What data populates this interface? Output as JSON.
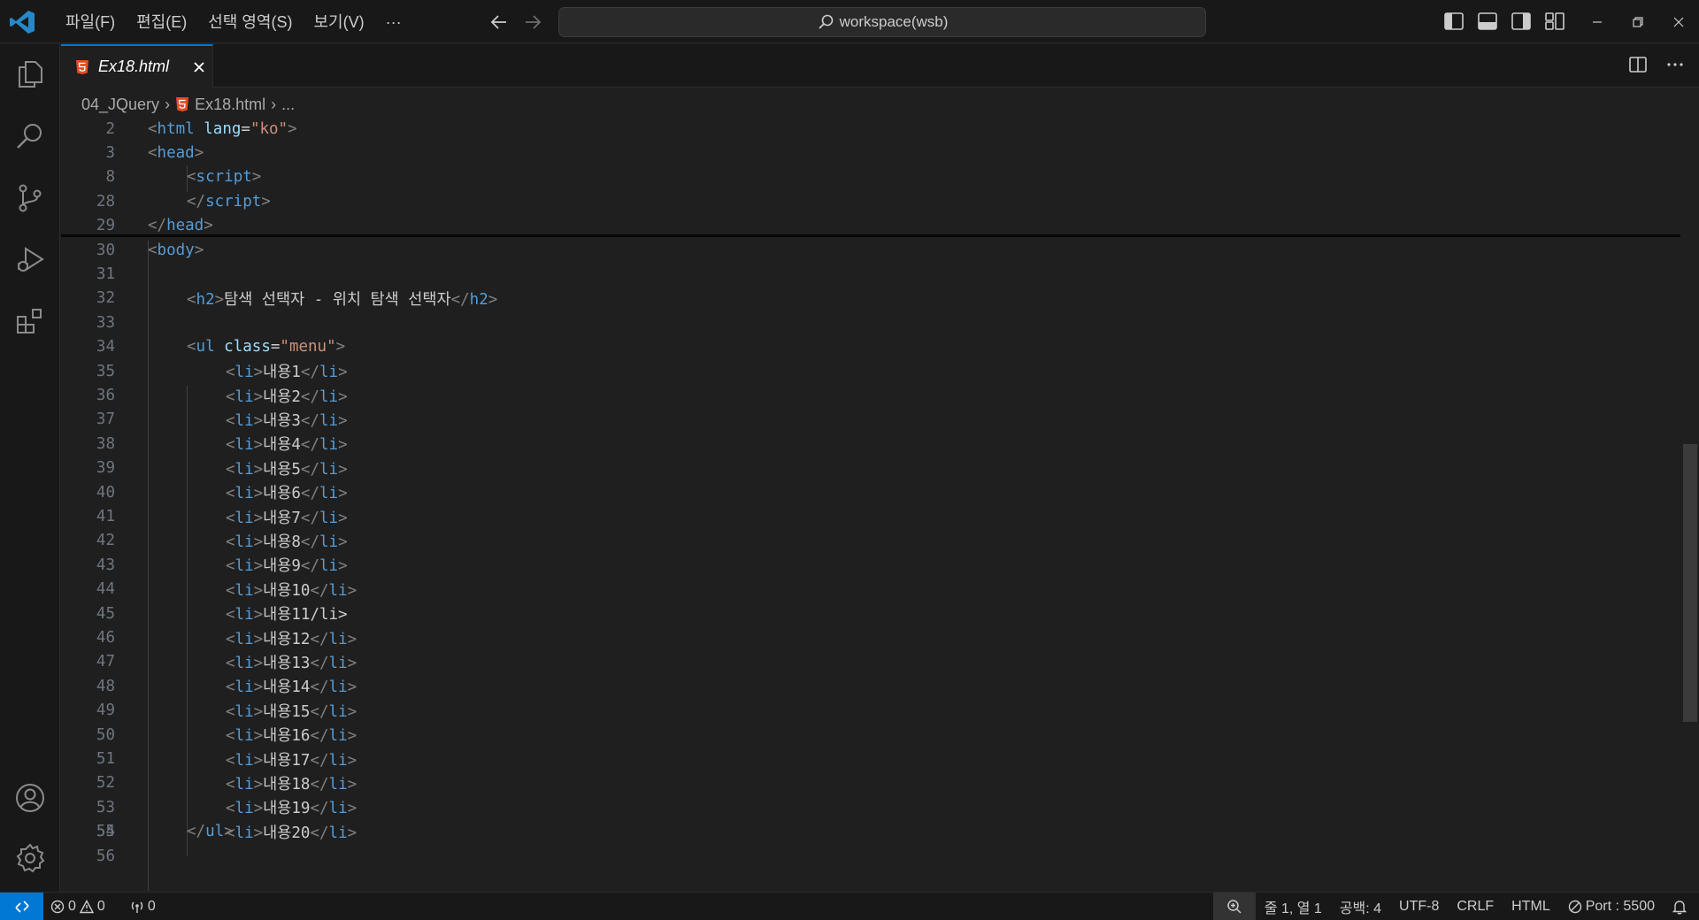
{
  "titlebar": {
    "menus": [
      "파일(F)",
      "편집(E)",
      "선택 영역(S)",
      "보기(V)",
      "···"
    ],
    "search_text": "workspace(wsb)"
  },
  "tab": {
    "label": "Ex18.html",
    "icon": "html5-icon"
  },
  "breadcrumb": {
    "folder": "04_JQuery",
    "file": "Ex18.html",
    "more": "..."
  },
  "code_lines": [
    {
      "n": "2"
    },
    {
      "n": "3"
    },
    {
      "n": "8"
    },
    {
      "n": "28"
    },
    {
      "n": "29"
    },
    {
      "n": "30"
    },
    {
      "n": "31"
    },
    {
      "n": "32"
    },
    {
      "n": "33"
    },
    {
      "n": "34"
    },
    {
      "n": "35"
    },
    {
      "n": "36"
    },
    {
      "n": "37"
    },
    {
      "n": "38"
    },
    {
      "n": "39"
    },
    {
      "n": "40"
    },
    {
      "n": "41"
    },
    {
      "n": "42"
    },
    {
      "n": "43"
    },
    {
      "n": "44"
    },
    {
      "n": "45"
    },
    {
      "n": "46"
    },
    {
      "n": "47"
    },
    {
      "n": "48"
    },
    {
      "n": "49"
    },
    {
      "n": "50"
    },
    {
      "n": "51"
    },
    {
      "n": "52"
    },
    {
      "n": "53"
    },
    {
      "n": "54"
    },
    {
      "n": "55"
    },
    {
      "n": "56"
    }
  ],
  "code": {
    "html_lang_attr": "lang",
    "html_lang_val": "\"ko\"",
    "ul_class_attr": "class",
    "ul_class_val": "\"menu\"",
    "h2_text": "탐색 선택자 - 위치 탐색 선택자",
    "li_prefix": "내용",
    "li_numbers": [
      "1",
      "2",
      "3",
      "4",
      "5",
      "6",
      "7",
      "8",
      "9",
      "10",
      "11",
      "12",
      "13",
      "14",
      "15",
      "16",
      "17",
      "18",
      "19",
      "20"
    ],
    "line45_tail": "/li>"
  },
  "statusbar": {
    "errors": "0",
    "warnings": "0",
    "ports": "0",
    "position": "줄 1, 열 1",
    "indent": "공백: 4",
    "encoding": "UTF-8",
    "eol": "CRLF",
    "language": "HTML",
    "port": "Port : 5500"
  },
  "colors": {
    "accent": "#0078d4",
    "tag": "#569cd6",
    "attr": "#9cdcfe",
    "string": "#ce9178",
    "html_icon": "#e44d26"
  }
}
